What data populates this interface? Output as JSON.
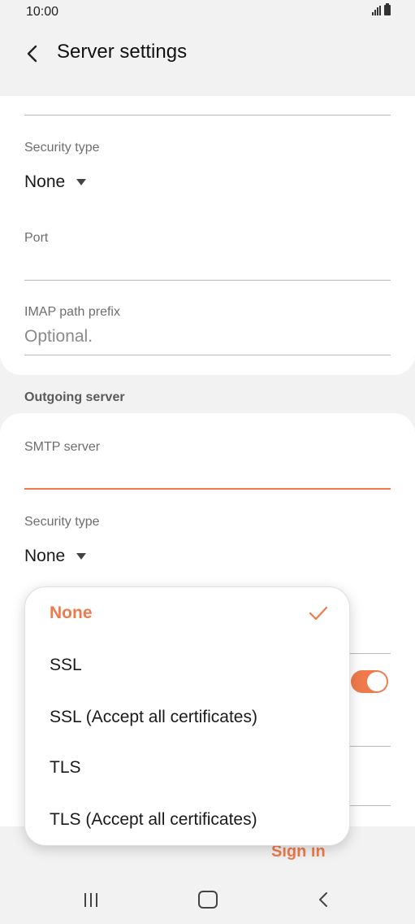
{
  "status_bar": {
    "time": "10:00"
  },
  "header": {
    "title": "Server settings"
  },
  "incoming": {
    "security_type_label": "Security type",
    "security_type_value": "None",
    "port_label": "Port",
    "port_value": "",
    "imap_prefix_label": "IMAP path prefix",
    "imap_prefix_placeholder": "Optional."
  },
  "outgoing": {
    "section_title": "Outgoing server",
    "smtp_label": "SMTP server",
    "smtp_value": "",
    "security_type_label": "Security type",
    "security_type_value": "None"
  },
  "dropdown": {
    "options": [
      {
        "label": "None",
        "selected": true
      },
      {
        "label": "SSL",
        "selected": false
      },
      {
        "label": "SSL (Accept all certificates)",
        "selected": false
      },
      {
        "label": "TLS",
        "selected": false
      },
      {
        "label": "TLS (Accept all certificates)",
        "selected": false
      }
    ]
  },
  "footer": {
    "sign_in_label": "Sign in"
  },
  "colors": {
    "accent": "#ef7a4c",
    "background": "#f2f2f2",
    "card": "#ffffff"
  },
  "icons": {
    "back": "chevron-left-icon",
    "check": "check-icon",
    "nav_recent": "recent-apps-icon",
    "nav_home": "home-icon",
    "nav_back": "nav-back-icon"
  }
}
